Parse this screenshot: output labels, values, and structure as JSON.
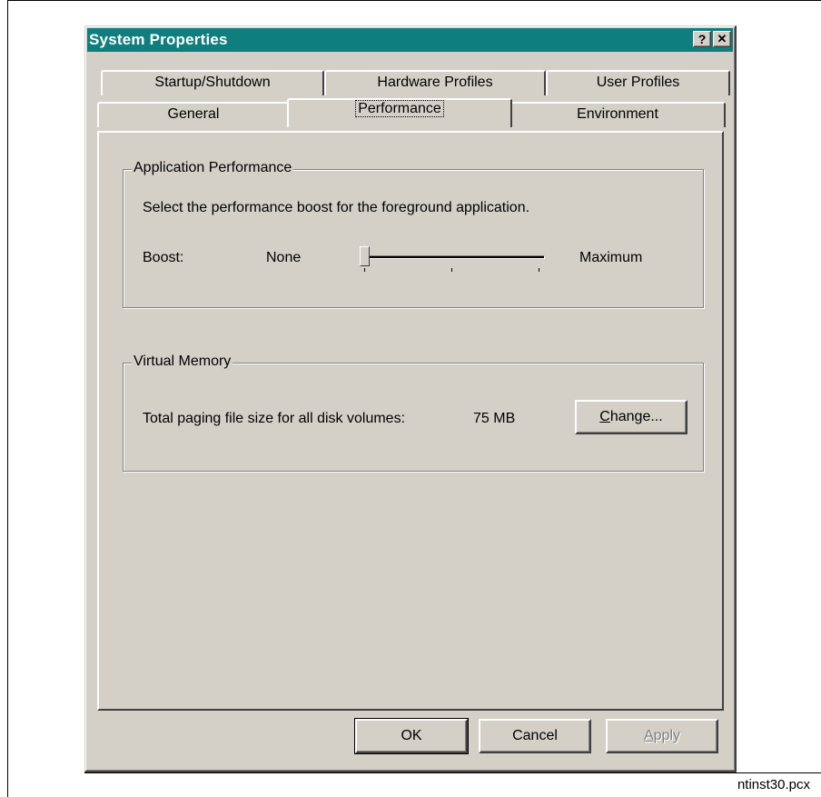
{
  "window": {
    "title": "System Properties",
    "help_button": "?",
    "close_button": "✕",
    "title_bar_color": "#0e7f7e"
  },
  "tabs_back_row": [
    "Startup/Shutdown",
    "Hardware Profiles",
    "User Profiles"
  ],
  "tabs_front_row": [
    "General",
    "Performance",
    "Environment"
  ],
  "active_tab": "Performance",
  "app_performance": {
    "group_title": "Application Performance",
    "description": "Select the performance boost for the foreground application.",
    "boost_label": "Boost:",
    "min_label": "None",
    "max_label": "Maximum",
    "boost_level": 0,
    "boost_steps": 3
  },
  "virtual_memory": {
    "group_title": "Virtual Memory",
    "paging_label": "Total paging file size for all disk volumes:",
    "paging_value": "75 MB",
    "change_button_rest": "hange...",
    "change_button_mnemonic": "C"
  },
  "footer": {
    "ok_label": "OK",
    "cancel_label": "Cancel",
    "apply_label": "Apply",
    "apply_mnemonic": "A",
    "apply_rest": "pply"
  },
  "caption": "ntinst30.pcx"
}
